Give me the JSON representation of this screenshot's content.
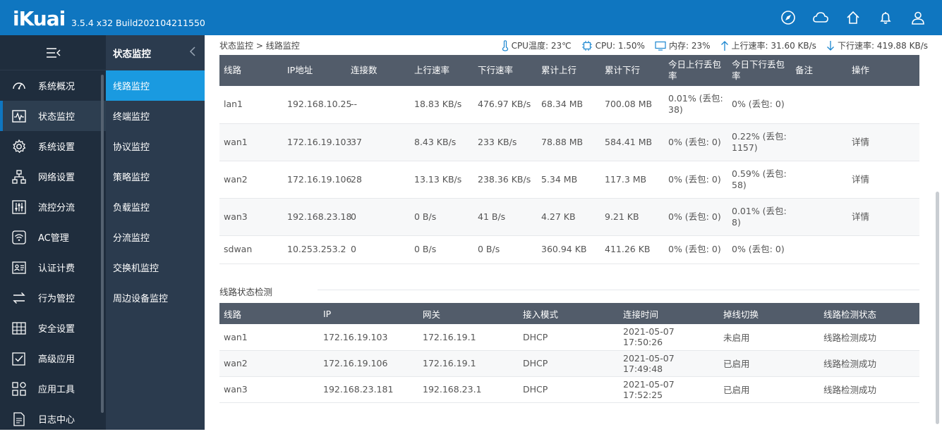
{
  "header": {
    "logo": "iKuai",
    "version": "3.5.4 x32 Build202104211550",
    "icons": [
      "compass-icon",
      "cloud-icon",
      "home-icon",
      "bell-icon",
      "user-icon"
    ]
  },
  "nav": {
    "items": [
      {
        "label": "系统概况",
        "icon": "dashboard-icon"
      },
      {
        "label": "状态监控",
        "icon": "pulse-icon"
      },
      {
        "label": "系统设置",
        "icon": "gear-icon"
      },
      {
        "label": "网络设置",
        "icon": "network-icon"
      },
      {
        "label": "流控分流",
        "icon": "sliders-icon"
      },
      {
        "label": "AC管理",
        "icon": "wifi-icon"
      },
      {
        "label": "认证计费",
        "icon": "id-card-icon"
      },
      {
        "label": "行为管控",
        "icon": "swap-icon"
      },
      {
        "label": "安全设置",
        "icon": "grid-icon"
      },
      {
        "label": "高级应用",
        "icon": "checklist-icon"
      },
      {
        "label": "应用工具",
        "icon": "apps-icon"
      },
      {
        "label": "日志中心",
        "icon": "document-icon"
      }
    ]
  },
  "subnav": {
    "title": "状态监控",
    "items": [
      "线路监控",
      "终端监控",
      "协议监控",
      "策略监控",
      "负载监控",
      "分流监控",
      "交换机监控",
      "周边设备监控"
    ]
  },
  "breadcrumb": {
    "parent": "状态监控",
    "sep": ">",
    "current": "线路监控"
  },
  "stats": {
    "cpu_temp": "CPU温度: 23℃",
    "cpu": "CPU: 1.50%",
    "mem": "内存: 23%",
    "up": "上行速率: 31.60 KB/s",
    "down": "下行速率: 419.88 KB/s"
  },
  "line_table": {
    "headers": [
      "线路",
      "IP地址",
      "连接数",
      "上行速率",
      "下行速率",
      "累计上行",
      "累计下行",
      "今日上行丢包率",
      "今日下行丢包率",
      "备注",
      "操作"
    ],
    "rows": [
      [
        "lan1",
        "192.168.10.25",
        "--",
        "18.83 KB/s",
        "476.97 KB/s",
        "68.34 MB",
        "700.08 MB",
        "0.01% (丢包: 38)",
        "0% (丢包: 0)",
        "",
        ""
      ],
      [
        "wan1",
        "172.16.19.103",
        "37",
        "8.43 KB/s",
        "233 KB/s",
        "78.88 MB",
        "584.41 MB",
        "0% (丢包: 0)",
        "0.22% (丢包: 1157)",
        "",
        "详情"
      ],
      [
        "wan2",
        "172.16.19.106",
        "28",
        "13.13 KB/s",
        "238.36 KB/s",
        "5.34 MB",
        "117.3 MB",
        "0% (丢包: 0)",
        "0.59% (丢包: 58)",
        "",
        "详情"
      ],
      [
        "wan3",
        "192.168.23.18",
        "0",
        "0 B/s",
        "41 B/s",
        "4.27 KB",
        "9.21 KB",
        "0% (丢包: 0)",
        "0.01% (丢包: 8)",
        "",
        "详情"
      ],
      [
        "sdwan",
        "10.253.253.2",
        "0",
        "0 B/s",
        "0 B/s",
        "360.94 KB",
        "411.26 KB",
        "0% (丢包: 0)",
        "0% (丢包: 0)",
        "",
        ""
      ]
    ]
  },
  "detect_section": {
    "title": "线路状态检测"
  },
  "detect_table": {
    "headers": [
      "线路",
      "IP",
      "网关",
      "接入模式",
      "连接时间",
      "掉线切换",
      "线路检测状态"
    ],
    "rows": [
      [
        "wan1",
        "172.16.19.103",
        "172.16.19.1",
        "DHCP",
        "2021-05-07 17:50:26",
        "未启用",
        "线路检测成功"
      ],
      [
        "wan2",
        "172.16.19.106",
        "172.16.19.1",
        "DHCP",
        "2021-05-07 17:49:48",
        "已启用",
        "线路检测成功"
      ],
      [
        "wan3",
        "192.168.23.181",
        "192.168.23.1",
        "DHCP",
        "2021-05-07 17:52:25",
        "已启用",
        "线路检测成功"
      ]
    ]
  },
  "colors": {
    "header": "#0f76c0",
    "nav": "#1f2d3d",
    "subnav": "#2b3b4e",
    "subnav_active": "#1a9ae0",
    "table_head": "#525c6a",
    "link": "#1a86d0",
    "success": "#28b487"
  }
}
